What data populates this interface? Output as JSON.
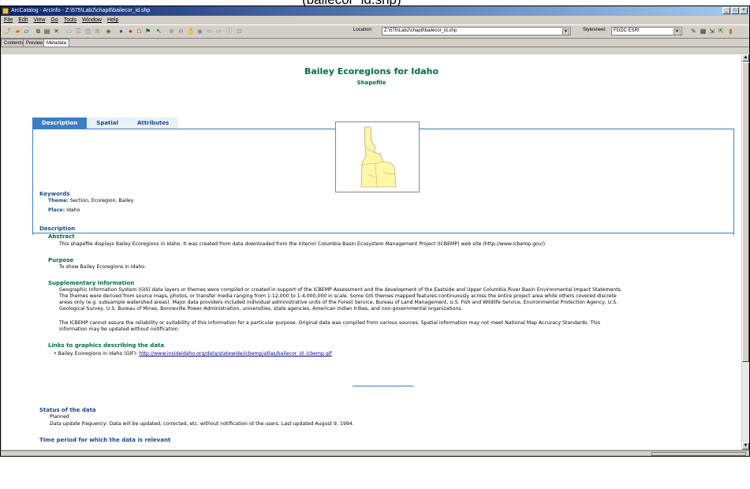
{
  "caption": "(bailecor_id.shp)",
  "window": {
    "title": "ArcCatalog - ArcInfo - Z:\\575\\Lab2\\chap8\\bailecor_id.shp",
    "buttons": [
      "_",
      "□",
      "×"
    ]
  },
  "menu": [
    "File",
    "Edit",
    "View",
    "Go",
    "Tools",
    "Window",
    "Help"
  ],
  "toolbar": {
    "location_label": "Location:",
    "location_value": "Z:\\575\\Lab2\\chap8\\bailecor_id.shp",
    "stylesheet_label": "Stylesheet:",
    "stylesheet_value": "FGDC ESRI"
  },
  "view_tabs": [
    "Contents",
    "Preview",
    "Metadata"
  ],
  "doc": {
    "title": "Bailey Ecoregions for Idaho",
    "subtitle": "Shapefile",
    "tabs": [
      "Description",
      "Spatial",
      "Attributes"
    ],
    "keywords": {
      "heading": "Keywords",
      "theme_label": "Theme:",
      "theme_value": "Section, Ecoregion, Bailey",
      "place_label": "Place:",
      "place_value": "Idaho"
    },
    "description": {
      "heading": "Description",
      "abstract_heading": "Abstract",
      "abstract_text": "This shapefile displays Bailey Ecoregions in Idaho.  It was created from data downloaded from the Interior Columbia Basin Ecosystem Management Project (ICBEMP) web site (http://www.icbemp.gov/).",
      "purpose_heading": "Purpose",
      "purpose_text": "To show Bailey Ecoregions in Idaho.",
      "supp_heading": "Supplementary Information",
      "supp_lines": [
        "Geographic Information System (GIS) data layers or themes were compiled or created in support of the ICBEMP Assessment and the development of the Eastside and Upper Columbia River Basin Environmental Impact Statements.",
        "The themes were derived from source maps, photos, or transfer media ranging from 1:12,000 to 1:4,000,000 in scale. Some GIS themes mapped features continuously across the entire project area while others covered discrete",
        "areas only (e.g. subsample watershed areas). Major data providers included individual administrative units of the Forest Service, Bureau of Land Management, U.S. Fish and Wildlife Service, Environmental Protection Agency, U.S.",
        "Geological Survey, U.S. Bureau of Mines, Bonneville Power Administration, universities, state agencies, American Indian tribes, and non-governmental organizations."
      ],
      "supp_lines2": [
        "The ICBEMP cannot assure the reliability or suitability of this information for a particular purpose.  Original data was compiled from various sources.  Spatial information may not meet National Map Accuracy Standards.  This",
        "information may be updated without notification."
      ],
      "links_heading": "Links to graphics describing the data",
      "link_prefix": "Bailey Ecoregions in Idaho (GIF):",
      "link_url": "http://www.insideidaho.org/data/statewide/icbemp/atlas/bailecor_id_icbemp.gif"
    },
    "status": {
      "heading": "Status of the data",
      "value": "Planned",
      "freq_label": "Data update frequency:",
      "freq_value": "Data will be updated, corrected, etc. without notification ot the users. Last updated August 9, 1994."
    },
    "time_heading": "Time period for which the data is relevant"
  }
}
